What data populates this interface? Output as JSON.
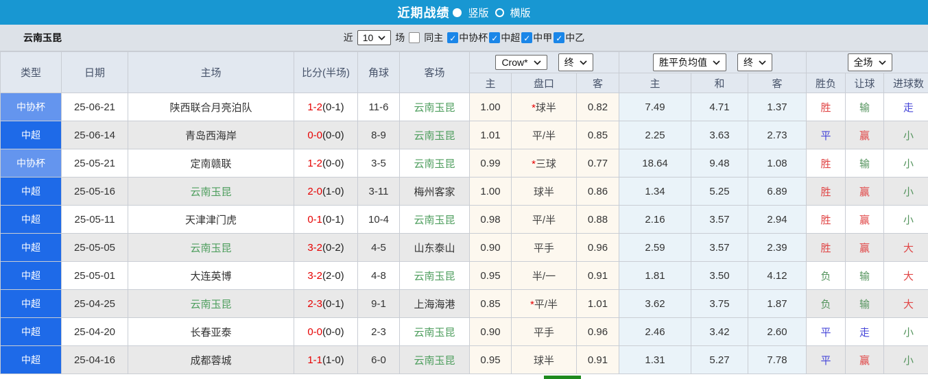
{
  "titlebar": {
    "title": "近期战绩",
    "radio_vertical_label": "竖版",
    "radio_horizontal_label": "横版",
    "radio_selected": "竖版"
  },
  "filter": {
    "team_name": "云南玉昆",
    "near_label": "近",
    "count_value": "10",
    "games_label": "场",
    "same_home": {
      "label": "同主",
      "checked": false
    },
    "leagues": [
      {
        "label": "中协杯",
        "checked": true
      },
      {
        "label": "中超",
        "checked": true
      },
      {
        "label": "中甲",
        "checked": true
      },
      {
        "label": "中乙",
        "checked": true
      }
    ]
  },
  "table": {
    "headers": {
      "type": "类型",
      "date": "日期",
      "home": "主场",
      "score": "比分(半场)",
      "corner": "角球",
      "away": "客场",
      "odds_home": "主",
      "handicap": "盘口",
      "odds_away": "客",
      "avg_home": "主",
      "avg_draw": "和",
      "avg_away": "客",
      "result": "胜负",
      "handicap_result": "让球",
      "goals": "进球数"
    },
    "selects": {
      "bookmaker": "Crow*",
      "odds_time_left": "终",
      "avg_type": "胜平负均值",
      "odds_time_right": "终",
      "scope": "全场"
    },
    "rows": [
      {
        "league": "中协杯",
        "league_class": "lg-cup",
        "date": "25-06-21",
        "home": "陕西联合月亮泊队",
        "home_self": false,
        "score": "1-2",
        "half": "(0-1)",
        "corner": "11-6",
        "away": "云南玉昆",
        "away_self": true,
        "odds_home": "1.00",
        "handicap_star": true,
        "handicap": "球半",
        "odds_away": "0.82",
        "avg_home": "7.49",
        "avg_draw": "4.71",
        "avg_away": "1.37",
        "result": "胜",
        "result_c": "c-red",
        "give": "输",
        "give_c": "c-green",
        "goals": "走",
        "goals_c": "c-blue"
      },
      {
        "league": "中超",
        "league_class": "lg-super",
        "date": "25-06-14",
        "home": "青岛西海岸",
        "home_self": false,
        "score": "0-0",
        "half": "(0-0)",
        "corner": "8-9",
        "away": "云南玉昆",
        "away_self": true,
        "odds_home": "1.01",
        "handicap_star": false,
        "handicap": "平/半",
        "odds_away": "0.85",
        "avg_home": "2.25",
        "avg_draw": "3.63",
        "avg_away": "2.73",
        "result": "平",
        "result_c": "c-blue",
        "give": "赢",
        "give_c": "c-red",
        "goals": "小",
        "goals_c": "c-green"
      },
      {
        "league": "中协杯",
        "league_class": "lg-cup",
        "date": "25-05-21",
        "home": "定南赣联",
        "home_self": false,
        "score": "1-2",
        "half": "(0-0)",
        "corner": "3-5",
        "away": "云南玉昆",
        "away_self": true,
        "odds_home": "0.99",
        "handicap_star": true,
        "handicap": "三球",
        "odds_away": "0.77",
        "avg_home": "18.64",
        "avg_draw": "9.48",
        "avg_away": "1.08",
        "result": "胜",
        "result_c": "c-red",
        "give": "输",
        "give_c": "c-green",
        "goals": "小",
        "goals_c": "c-green"
      },
      {
        "league": "中超",
        "league_class": "lg-super",
        "date": "25-05-16",
        "home": "云南玉昆",
        "home_self": true,
        "score": "2-0",
        "half": "(1-0)",
        "corner": "3-11",
        "away": "梅州客家",
        "away_self": false,
        "odds_home": "1.00",
        "handicap_star": false,
        "handicap": "球半",
        "odds_away": "0.86",
        "avg_home": "1.34",
        "avg_draw": "5.25",
        "avg_away": "6.89",
        "result": "胜",
        "result_c": "c-red",
        "give": "赢",
        "give_c": "c-red",
        "goals": "小",
        "goals_c": "c-green"
      },
      {
        "league": "中超",
        "league_class": "lg-super",
        "date": "25-05-11",
        "home": "天津津门虎",
        "home_self": false,
        "score": "0-1",
        "half": "(0-1)",
        "corner": "10-4",
        "away": "云南玉昆",
        "away_self": true,
        "odds_home": "0.98",
        "handicap_star": false,
        "handicap": "平/半",
        "odds_away": "0.88",
        "avg_home": "2.16",
        "avg_draw": "3.57",
        "avg_away": "2.94",
        "result": "胜",
        "result_c": "c-red",
        "give": "赢",
        "give_c": "c-red",
        "goals": "小",
        "goals_c": "c-green"
      },
      {
        "league": "中超",
        "league_class": "lg-super",
        "date": "25-05-05",
        "home": "云南玉昆",
        "home_self": true,
        "score": "3-2",
        "half": "(0-2)",
        "corner": "4-5",
        "away": "山东泰山",
        "away_self": false,
        "odds_home": "0.90",
        "handicap_star": false,
        "handicap": "平手",
        "odds_away": "0.96",
        "avg_home": "2.59",
        "avg_draw": "3.57",
        "avg_away": "2.39",
        "result": "胜",
        "result_c": "c-red",
        "give": "赢",
        "give_c": "c-red",
        "goals": "大",
        "goals_c": "c-red"
      },
      {
        "league": "中超",
        "league_class": "lg-super",
        "date": "25-05-01",
        "home": "大连英博",
        "home_self": false,
        "score": "3-2",
        "half": "(2-0)",
        "corner": "4-8",
        "away": "云南玉昆",
        "away_self": true,
        "odds_home": "0.95",
        "handicap_star": false,
        "handicap": "半/一",
        "odds_away": "0.91",
        "avg_home": "1.81",
        "avg_draw": "3.50",
        "avg_away": "4.12",
        "result": "负",
        "result_c": "c-green",
        "give": "输",
        "give_c": "c-green",
        "goals": "大",
        "goals_c": "c-red"
      },
      {
        "league": "中超",
        "league_class": "lg-super",
        "date": "25-04-25",
        "home": "云南玉昆",
        "home_self": true,
        "score": "2-3",
        "half": "(0-1)",
        "corner": "9-1",
        "away": "上海海港",
        "away_self": false,
        "odds_home": "0.85",
        "handicap_star": true,
        "handicap": "平/半",
        "odds_away": "1.01",
        "avg_home": "3.62",
        "avg_draw": "3.75",
        "avg_away": "1.87",
        "result": "负",
        "result_c": "c-green",
        "give": "输",
        "give_c": "c-green",
        "goals": "大",
        "goals_c": "c-red"
      },
      {
        "league": "中超",
        "league_class": "lg-super",
        "date": "25-04-20",
        "home": "长春亚泰",
        "home_self": false,
        "score": "0-0",
        "half": "(0-0)",
        "corner": "2-3",
        "away": "云南玉昆",
        "away_self": true,
        "odds_home": "0.90",
        "handicap_star": false,
        "handicap": "平手",
        "odds_away": "0.96",
        "avg_home": "2.46",
        "avg_draw": "3.42",
        "avg_away": "2.60",
        "result": "平",
        "result_c": "c-blue",
        "give": "走",
        "give_c": "c-blue",
        "goals": "小",
        "goals_c": "c-green"
      },
      {
        "league": "中超",
        "league_class": "lg-super",
        "date": "25-04-16",
        "home": "成都蓉城",
        "home_self": false,
        "score": "1-1",
        "half": "(1-0)",
        "corner": "6-0",
        "away": "云南玉昆",
        "away_self": true,
        "odds_home": "0.95",
        "handicap_star": false,
        "handicap": "球半",
        "odds_away": "0.91",
        "avg_home": "1.31",
        "avg_draw": "5.27",
        "avg_away": "7.78",
        "result": "平",
        "result_c": "c-blue",
        "give": "赢",
        "give_c": "c-red",
        "goals": "小",
        "goals_c": "c-green"
      }
    ]
  },
  "colors": {
    "topbar_blue": "#1897d2",
    "league_super_blue": "#1e6ae8",
    "league_cup_blue": "#6495ee",
    "score_red": "#e60000",
    "self_team_green": "#4e9e5e",
    "win_red": "#e04545",
    "draw_blue": "#4545d8",
    "lose_green": "#55945e",
    "odds_col_cream": "#fdf8ef",
    "avg_col_blue": "#eaf3f9",
    "alt_row_gray": "#e9e9e9",
    "bottom_bar_green": "#1e8a1e"
  }
}
